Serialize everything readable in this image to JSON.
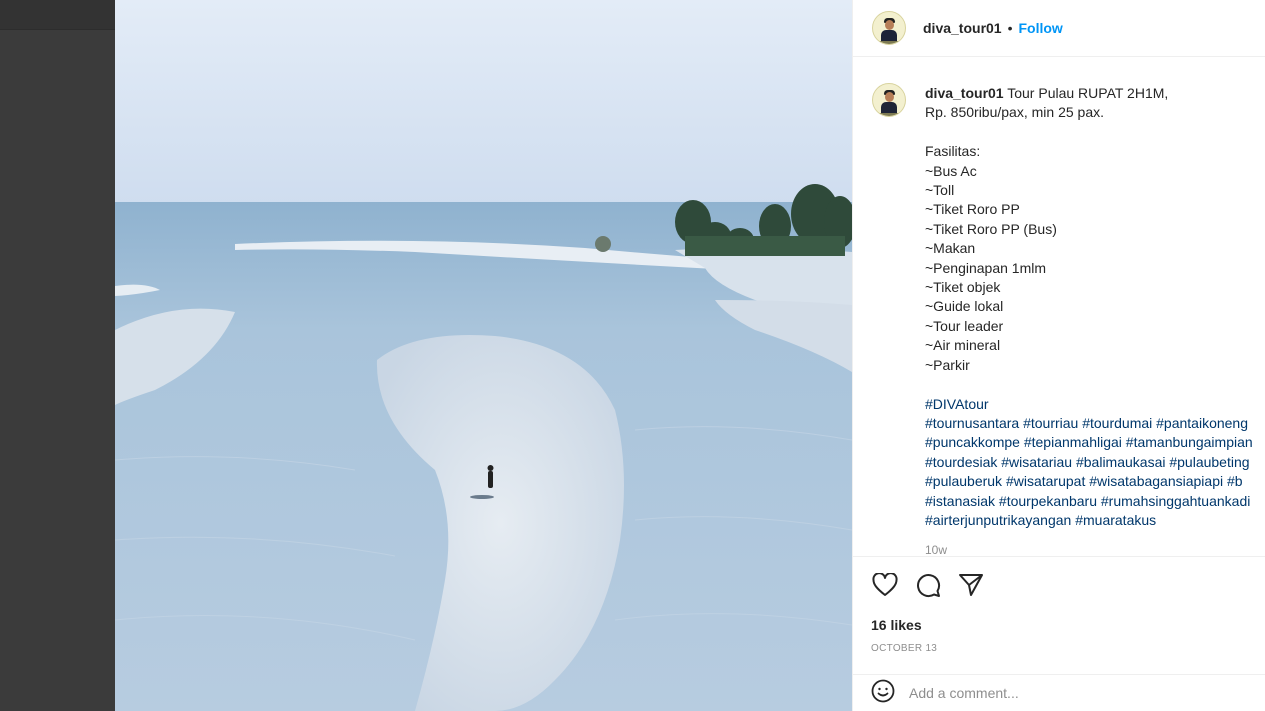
{
  "post": {
    "username": "diva_tour01",
    "separator": "•",
    "follow_label": "Follow",
    "caption_lines": [
      "Tour Pulau RUPAT 2H1M,",
      "Rp. 850ribu/pax, min 25 pax.",
      "",
      "Fasilitas:",
      "~Bus Ac",
      "~Toll",
      "~Tiket Roro PP",
      "~Tiket Roro PP (Bus)",
      "~Makan",
      "~Penginapan 1mlm",
      "~Tiket objek",
      "~Guide lokal",
      "~Tour leader",
      "~Air mineral",
      "~Parkir",
      ""
    ],
    "hashtag_lines": [
      "#DIVAtour",
      "#tournusantara #tourriau #tourdumai #pantaikoneng",
      "#puncakkompe #tepianmahligai #tamanbungaimpian",
      "#tourdesiak #wisatariau #balimaukasai #pulaubeting",
      "#pulauberuk #wisatarupat #wisatabagansiapiapi #b",
      "#istanasiak #tourpekanbaru #rumahsinggahtuankadi",
      "#airterjunputrikayangan #muaratakus"
    ],
    "time_ago": "10w",
    "likes": "16 likes",
    "date": "OCTOBER 13",
    "comment_placeholder": "Add a comment...",
    "image_icon": "beach-aerial-photo"
  },
  "icons": {
    "like": "heart-icon",
    "comment": "comment-icon",
    "share": "share-icon",
    "emoji": "emoji-icon"
  },
  "colors": {
    "link": "#0095f6",
    "hashtag": "#00376b",
    "muted": "#8e8e8e"
  }
}
